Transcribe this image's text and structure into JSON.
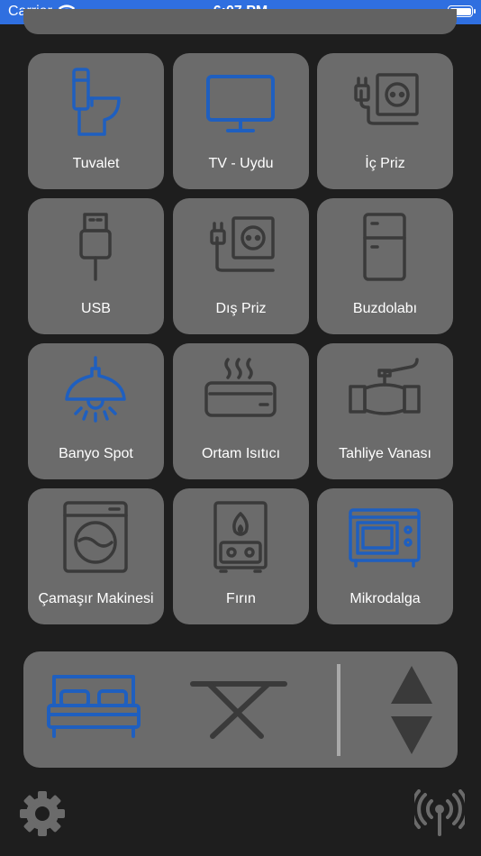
{
  "status_bar": {
    "carrier": "Carrier",
    "time": "6:07 PM"
  },
  "colors": {
    "blue_icon": "#1f5fbf",
    "grey_icon": "#3a3a3a",
    "tile": "#6b6b6b",
    "background": "#1e1e1e"
  },
  "devices": [
    {
      "label": "Tuvalet",
      "icon": "toilet-icon",
      "active": true
    },
    {
      "label": "TV - Uydu",
      "icon": "tv-icon",
      "active": true
    },
    {
      "label": "İç Priz",
      "icon": "indoor-socket-icon",
      "active": false
    },
    {
      "label": "USB",
      "icon": "usb-icon",
      "active": false
    },
    {
      "label": "Dış Priz",
      "icon": "outdoor-socket-icon",
      "active": false
    },
    {
      "label": "Buzdolabı",
      "icon": "fridge-icon",
      "active": false
    },
    {
      "label": "Banyo Spot",
      "icon": "lamp-icon",
      "active": true
    },
    {
      "label": "Ortam Isıtıcı",
      "icon": "heater-icon",
      "active": false
    },
    {
      "label": "Tahliye Vanası",
      "icon": "valve-icon",
      "active": false
    },
    {
      "label": "Çamaşır Makinesi",
      "icon": "washing-machine-icon",
      "active": false
    },
    {
      "label": "Fırın",
      "icon": "oven-icon",
      "active": false
    },
    {
      "label": "Mikrodalga",
      "icon": "microwave-icon",
      "active": true
    }
  ],
  "bottom_panel": {
    "bed": {
      "icon": "bed-icon",
      "active": true
    },
    "table": {
      "icon": "table-icon",
      "active": false
    },
    "up": "arrow-up-icon",
    "down": "arrow-down-icon"
  },
  "footer": {
    "left": "gear-icon",
    "right": "antenna-icon"
  }
}
